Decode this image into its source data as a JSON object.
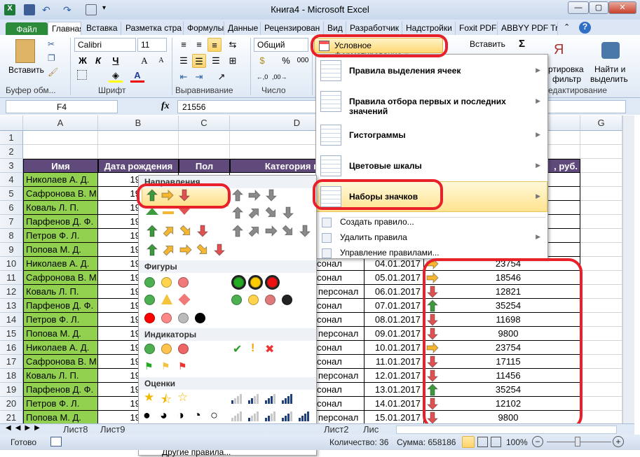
{
  "window": {
    "title": "Книга4  -  Microsoft Excel",
    "min": "—",
    "max": "▢",
    "close": "✕"
  },
  "tabs": [
    "Файл",
    "Главная",
    "Вставка",
    "Разметка стра",
    "Формулы",
    "Данные",
    "Рецензирован",
    "Вид",
    "Разработчик",
    "Надстройки",
    "Foxit PDF",
    "ABBYY PDF Trar"
  ],
  "ribbon": {
    "paste": "Вставить",
    "clipboard": "Буфер обм...",
    "font_group": "Шрифт",
    "align_group": "Выравнивание",
    "number_group": "Число",
    "editing_group": "едактирование",
    "font_name": "Calibri",
    "font_size": "11",
    "bold": "Ж",
    "italic": "К",
    "underline": "Ч",
    "number_format": "Общий",
    "percent": "%",
    "thousands": "000",
    "cond_format": "Условное форматирование",
    "insert": "Вставить",
    "sum": "Σ",
    "sort1": "ртировка",
    "sort2": "фильтр",
    "find1": "Найти и",
    "find2": "выделить"
  },
  "formula_bar": {
    "cell": "F4",
    "fx": "fx",
    "value": "21556"
  },
  "columns": [
    "A",
    "B",
    "C",
    "D",
    "E",
    "F",
    "G"
  ],
  "rows": [
    "1",
    "2",
    "3",
    "4",
    "5",
    "6",
    "7",
    "8",
    "9",
    "10",
    "11",
    "12",
    "13",
    "14",
    "15",
    "16",
    "17",
    "18",
    "19",
    "20",
    "21"
  ],
  "table": {
    "headers": [
      "Имя",
      "Дата рождения",
      "Пол",
      "Категория пер",
      ", руб."
    ],
    "names": [
      "Николаев А. Д.",
      "Сафронова В. М.",
      "Коваль Л. П.",
      "Парфенов Д. Ф.",
      "Петров Ф. Л.",
      "Попова М. Д.",
      "Николаев А. Д.",
      "Сафронова В. М.",
      "Коваль Л. П.",
      "Парфенов Д. Ф.",
      "Петров Ф. Л.",
      "Попова М. Д.",
      "Николаев А. Д.",
      "Сафронова В. М.",
      "Коваль Л. П.",
      "Парфенов Д. Ф.",
      "Петров Ф. Л.",
      "Попова М. Д."
    ],
    "birth_partial": "19",
    "category_partial": [
      "сонал",
      "сонал",
      "персонал",
      "сонал",
      "сонал",
      "персонал",
      "сонал",
      "сонал",
      "персонал",
      "сонал",
      "сонал",
      "персонал"
    ],
    "dates": [
      "04.01.2017",
      "05.01.2017",
      "06.01.2017",
      "07.01.2017",
      "08.01.2017",
      "09.01.2017",
      "10.01.2017",
      "11.01.2017",
      "12.01.2017",
      "13.01.2017",
      "14.01.2017",
      "15.01.2017"
    ],
    "salary": [
      "23754",
      "18546",
      "12821",
      "35254",
      "11698",
      "9800",
      "23754",
      "17115",
      "11456",
      "35254",
      "12102",
      "9800"
    ],
    "salary_icons": [
      "right",
      "right",
      "down",
      "up",
      "down",
      "down",
      "right",
      "down",
      "down",
      "up",
      "down",
      "down"
    ]
  },
  "cf_menu": {
    "items": [
      "Правила выделения ячеек",
      "Правила отбора первых и последних значений",
      "Гистограммы",
      "Цветовые шкалы",
      "Наборы значков"
    ],
    "actions": [
      "Создать правило...",
      "Удалить правила",
      "Управление правилами..."
    ]
  },
  "icon_gallery": {
    "sections": [
      "Направления",
      "Фигуры",
      "Индикаторы",
      "Оценки"
    ],
    "more_rules": "Другие правила..."
  },
  "sheets": [
    "Лист8",
    "Лист9",
    "Лист2",
    "Лис"
  ],
  "status": {
    "ready": "Готово",
    "count": "Количество: 36",
    "sum": "Сумма: 658186",
    "zoom": "100%"
  },
  "colors": {
    "header": "#604a7b",
    "names": "#92d050",
    "highlight": "#e8202a",
    "up": "#3c9a3c",
    "right": "#f5b731",
    "down": "#e05252"
  }
}
